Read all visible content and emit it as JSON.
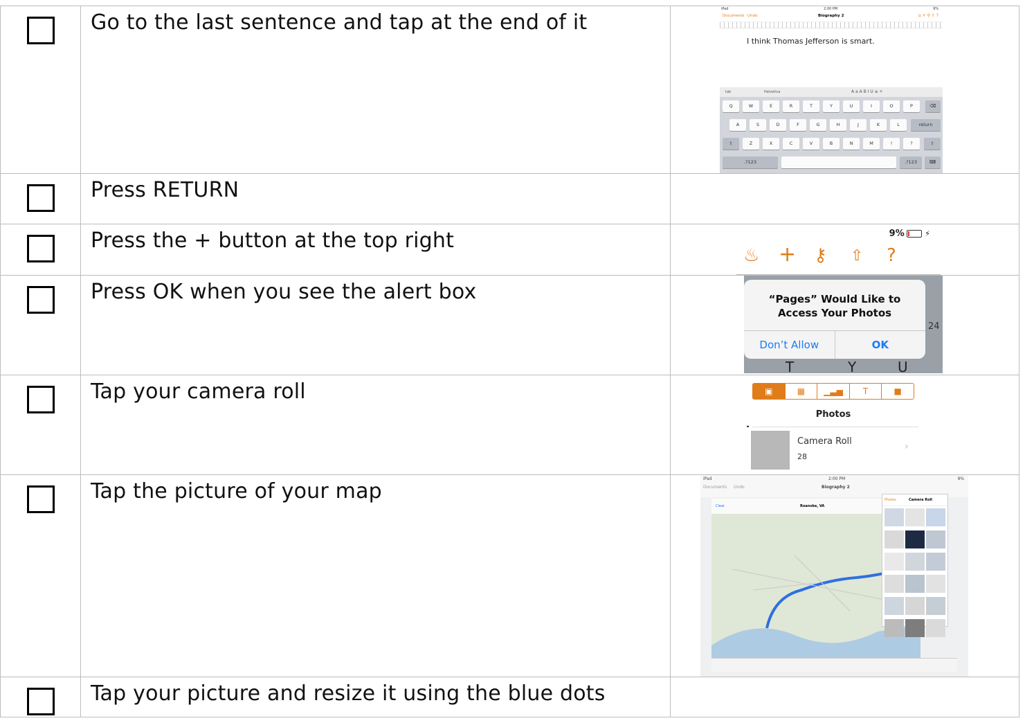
{
  "steps": [
    {
      "text": "Go to the last sentence and tap at the end of it"
    },
    {
      "text": "Press RETURN"
    },
    {
      "text": "Press the + button at the top right"
    },
    {
      "text": "Press OK when you see the alert box"
    },
    {
      "text": "Tap your camera roll"
    },
    {
      "text": "Tap the picture of your map"
    },
    {
      "text": "Tap your picture and resize it using the blue dots"
    }
  ],
  "shot1": {
    "status_left": "iPad",
    "status_time": "2:00 PM",
    "status_right": "9%",
    "documents": "Documents",
    "undo": "Undo",
    "title": "Biography 2",
    "sentence": "I think Thomas Jefferson is smart.",
    "tab": "tab",
    "font": "Helvetica",
    "row1": [
      "Q",
      "W",
      "E",
      "R",
      "T",
      "Y",
      "U",
      "I",
      "O",
      "P"
    ],
    "row2": [
      "A",
      "S",
      "D",
      "F",
      "G",
      "H",
      "J",
      "K",
      "L"
    ],
    "row3": [
      "Z",
      "X",
      "C",
      "V",
      "B",
      "N",
      "M",
      "!",
      "?"
    ],
    "return": "return",
    "num": ".?123"
  },
  "shot3": {
    "battery": "9%",
    "icons": [
      "brush-icon",
      "plus-icon",
      "wrench-icon",
      "share-icon",
      "help-icon"
    ]
  },
  "shot4": {
    "title": "“Pages” Would Like to Access Your Photos",
    "dont_allow": "Don’t Allow",
    "ok": "OK",
    "side_number": "24",
    "keys": [
      "T",
      "Y",
      "U"
    ]
  },
  "shot5": {
    "heading": "Photos",
    "album": "Camera Roll",
    "count": "28",
    "side_letter": "r"
  },
  "shot6": {
    "status_left": "iPad",
    "status_time": "2:00 PM",
    "status_right": "9%",
    "documents": "Documents",
    "undo": "Undo",
    "title": "Biography 2",
    "back": "Photos",
    "panel_title": "Camera Roll",
    "route": "Roanoke, VA",
    "clear": "Clear"
  },
  "colors": {
    "accent": "#e07d1a",
    "ios_blue": "#1a7cf5"
  }
}
